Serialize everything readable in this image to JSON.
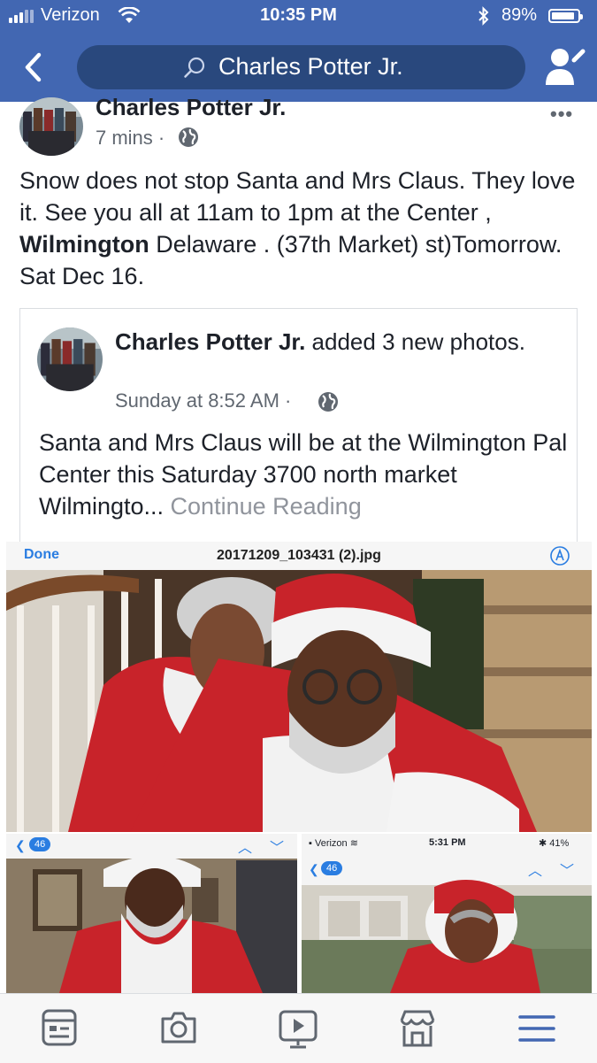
{
  "status_bar": {
    "carrier": "Verizon",
    "time": "10:35 PM",
    "battery": "89%",
    "battery_level": 0.89
  },
  "search": {
    "text": "Charles Potter Jr."
  },
  "post": {
    "author": "Charles Potter Jr.",
    "time": "7 mins",
    "body_pre": "Snow does not stop Santa and Mrs Claus. They love it. See you all at 11am  to 1pm at the Center ,",
    "body_bold": "Wilmington",
    "body_post": "Delaware .  (37th Market) st)Tomorrow. Sat Dec 16."
  },
  "shared_post": {
    "author": "Charles Potter Jr.",
    "action": "added 3 new photos.",
    "time": "Sunday at 8:52 AM",
    "body": "Santa and Mrs Claus will be at the Wilmington Pal Center this Saturday 3700 north market  Wilmingto...",
    "continue_label": "Continue Reading"
  },
  "photo_main": {
    "done": "Done",
    "filename": "20171209_103431 (2).jpg"
  },
  "photo_left": {
    "back_count": "46"
  },
  "photo_right": {
    "carrier": "Verizon",
    "time": "5:31 PM",
    "battery": "41%",
    "back_count": "46"
  },
  "colors": {
    "brand": "#4267b2",
    "accent": "#4267b2"
  },
  "bottom_tabs": [
    "news-feed-icon",
    "camera-icon",
    "video-icon",
    "marketplace-icon",
    "menu-icon"
  ]
}
